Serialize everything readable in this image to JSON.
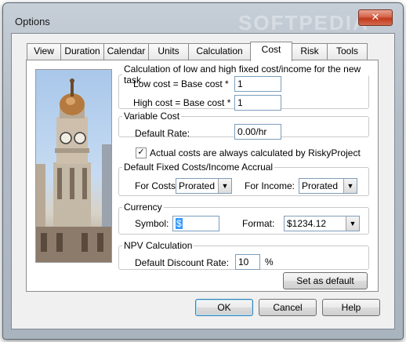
{
  "window": {
    "title": "Options",
    "watermark": "SOFTPEDIA",
    "close_glyph": "✕"
  },
  "tabs": [
    "View",
    "Duration",
    "Calendar",
    "Units",
    "Calculation",
    "Cost",
    "Risk",
    "Tools"
  ],
  "active_tab": "Cost",
  "fixed_cost": {
    "legend": "Calculation of low and high fixed cost/income for the new task",
    "low_label": "Low cost = Base cost *",
    "low_value": "1",
    "high_label": "High cost = Base cost *",
    "high_value": "1"
  },
  "variable_cost": {
    "legend": "Variable Cost",
    "rate_label": "Default Rate:",
    "rate_value": "0.00/hr"
  },
  "actual_costs": {
    "label": "Actual costs are always calculated by RiskyProject",
    "checked": true,
    "check_glyph": "✓"
  },
  "accrual": {
    "legend": "Default Fixed Costs/Income Accrual",
    "costs_label": "For Costs:",
    "costs_value": "Prorated",
    "income_label": "For Income:",
    "income_value": "Prorated"
  },
  "currency": {
    "legend": "Currency",
    "symbol_label": "Symbol:",
    "symbol_value": "$",
    "format_label": "Format:",
    "format_value": "$1234.12"
  },
  "npv": {
    "legend": "NPV Calculation",
    "rate_label": "Default Discount Rate:",
    "rate_value": "10",
    "unit": "%"
  },
  "buttons": {
    "set_default": "Set as default",
    "ok": "OK",
    "cancel": "Cancel",
    "help": "Help"
  },
  "icons": {
    "dropdown_arrow": "▼"
  }
}
